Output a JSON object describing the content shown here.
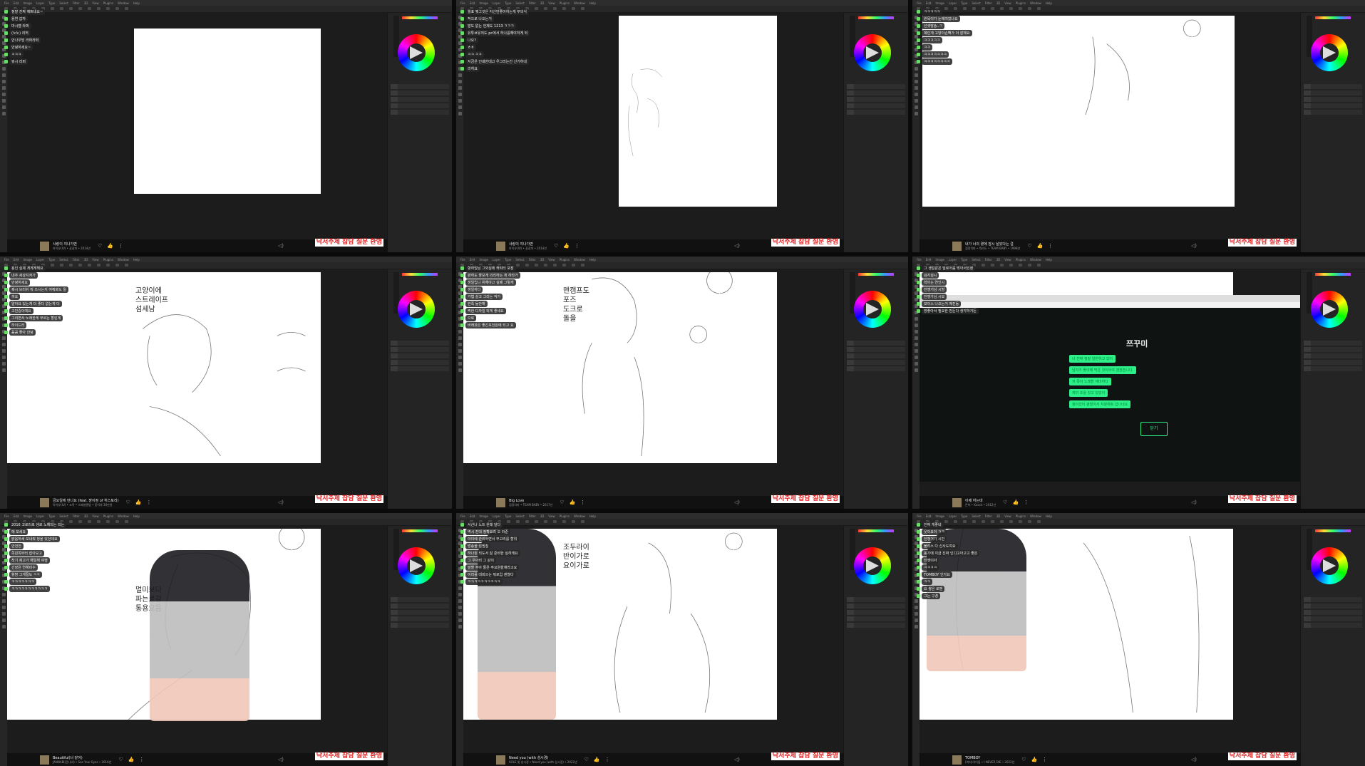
{
  "menu": [
    "File",
    "Edit",
    "Image",
    "Layer",
    "Type",
    "Select",
    "Filter",
    "3D",
    "View",
    "Plugins",
    "Window",
    "Help"
  ],
  "banner_text": "낙서주제 잡담 질문 환영",
  "tiles": [
    {
      "song": {
        "title": "사랑이 지나가면",
        "artist": "아이유(IU) • 꽃갈피 • 2014년"
      },
      "chat": [
        {
          "nick": "",
          "text": "정말 진짜 예쁘네요~"
        },
        {
          "nick": "",
          "text": "용연 갑자"
        },
        {
          "nick": "",
          "text": "마시멜 라퍼"
        },
        {
          "nick": "",
          "text": "(노노) 리허"
        },
        {
          "nick": "",
          "text": "안나우빙 라퍼라퍼"
        },
        {
          "nick": "",
          "text": "안녕하세요~"
        },
        {
          "nick": "",
          "text": "ㅋㅋㅋ"
        },
        {
          "nick": "",
          "text": "뭐시 리퍼"
        }
      ]
    },
    {
      "song": {
        "title": "사랑이 지나가면",
        "artist": "아이유(IU) • 꽃갈피 • 2014년"
      },
      "chat": [
        {
          "nick": "",
          "text": "월표 찢그것은 자신만좋아하는게 무의식"
        },
        {
          "nick": "",
          "text": "적으로 나오는거"
        },
        {
          "nick": "",
          "text": "말도 없는 언제도 1213 ㅋㅋㅋ"
        },
        {
          "nick": "",
          "text": "유튜브유저도 pc에서 하나를해야하게 되"
        },
        {
          "nick": "",
          "text": "나요?"
        },
        {
          "nick": "",
          "text": "ㅎㅎ"
        },
        {
          "nick": "",
          "text": "ㅋㅋ ㅋㅋ"
        },
        {
          "nick": "",
          "text": "지금은 인쇄한데고 우그리는건 신기하네"
        },
        {
          "nick": "",
          "text": "리허요"
        }
      ]
    },
    {
      "song": {
        "title": "내가 너의 곁에 잠시 살았다는 걸",
        "artist": "검정치마 • 뭐라도 • TEAM BABY • 1998년"
      },
      "chat": [
        {
          "nick": "",
          "text": "ㅋㅋㅋㅋㅋ"
        },
        {
          "nick": "",
          "text": "원목이가 눈에띄었나요"
        },
        {
          "nick": "",
          "text": "선셋방송..ㅋ"
        },
        {
          "nick": "",
          "text": "제인게 고양이손뼉가 더 잘해요"
        },
        {
          "nick": "",
          "text": "ㅋㅋㅋㅋㅋ"
        },
        {
          "nick": "",
          "text": "ㅋㅋ"
        },
        {
          "nick": "",
          "text": "ㅋㅋㅋㅋㅋㅋㅋ"
        },
        {
          "nick": "",
          "text": "ㅋㅋㅋㅋㅋㅋㅋㅋ"
        }
      ]
    },
    {
      "song": {
        "title": "금요일에 만나요 (feat. 장이정 of 히스토리)",
        "artist": "아이유(IU) • 조목 • 스페셜앨범 • 동이와 30만원"
      },
      "chat": [
        {
          "nick": "",
          "text": "용인 실제 게게게해요"
        },
        {
          "nick": "",
          "text": "내추 세상지켜가"
        },
        {
          "nick": "",
          "text": "안녕하세요"
        },
        {
          "nick": "",
          "text": "혹시 브러쉬 뭐 쓰시는지 여쭤봐도 될"
        },
        {
          "nick": "",
          "text": "까요"
        },
        {
          "nick": "",
          "text": "알아요 있는게 더 좋다 없는게 더"
        },
        {
          "nick": "",
          "text": "고민중이예요"
        },
        {
          "nick": "",
          "text": "그리면서 노래한게 부르는 할린게"
        },
        {
          "nick": "",
          "text": "하이드라"
        },
        {
          "nick": "",
          "text": "꼼꼼 좋아 안녕"
        }
      ],
      "notes": [
        "고양이에",
        "스트레이프",
        "섬세남"
      ]
    },
    {
      "song": {
        "title": "Big Love",
        "artist": "검정치마 • TEAM BABY • 2017년"
      },
      "chat": [
        {
          "nick": "",
          "text": "항하임님 그외실에 캐릭터 포장"
        },
        {
          "nick": "",
          "text": "판하도 꽃보게 의리하는 게 하라가"
        },
        {
          "nick": "",
          "text": "생일입니 위해야고 실패 그렇게"
        },
        {
          "nick": "",
          "text": "생일하다"
        },
        {
          "nick": "",
          "text": "가볍 살고 그리는 작가"
        },
        {
          "nick": "",
          "text": "한쪽 들안해"
        },
        {
          "nick": "",
          "text": "찍한 디자일 되게 좋네요"
        },
        {
          "nick": "",
          "text": "으로"
        },
        {
          "nick": "",
          "text": "바래왔은 좋긴포천원에 되고 요"
        }
      ],
      "notes": [
        "맨캠프도",
        "포즈",
        "도크로",
        "돌을"
      ]
    },
    {
      "song": {
        "title": "이제 하는대",
        "artist": "몬박 • Knock • 2012년"
      },
      "chat": [
        {
          "nick": "",
          "text": "그 생일같은 빌로어를 밖아서있정"
        },
        {
          "nick": "",
          "text": "검지설시"
        },
        {
          "nick": "",
          "text": "학이는 연인시"
        },
        {
          "nick": "",
          "text": "전쟁거님 시방"
        },
        {
          "nick": "",
          "text": "전쟁가님 시보"
        },
        {
          "nick": "",
          "text": "보이스 나오는거 께진동"
        },
        {
          "nick": "",
          "text": "방좋아서 필요한 만든다 생각하거든"
        }
      ],
      "browser": {
        "logo": "쯔꾸미",
        "bubbles": [
          "너 진짜 정말 일반하고 있어",
          "남자가 좋아해 먹은 것이어야 괜찮습니다.",
          "저 쪽이 노래할 재미하다",
          "재미 조용 짓고 있었어",
          "참이었어 괜찮아서 처분해줘 겁나네요"
        ],
        "close": "닫기"
      }
    },
    {
      "song": {
        "title": "Beautiful(너 같아)",
        "artist": "JANNABI(잔나비) • See Your Eyes • 2016년"
      },
      "chat": [
        {
          "nick": "",
          "text": "2016 고로러로 생로 노해되는 되는"
        },
        {
          "nick": "",
          "text": "에 보세요"
        },
        {
          "nick": "",
          "text": "맑음하세 보내줘 정을 있던데요"
        },
        {
          "nick": "",
          "text": "안전전"
        },
        {
          "nick": "",
          "text": "쪽왼쪽부터 잡아보고"
        },
        {
          "nick": "",
          "text": "착기 제고가 해일해 여행"
        },
        {
          "nick": "",
          "text": "긴장은 연해미수"
        },
        {
          "nick": "",
          "text": "항밤 그게절도 ㅋㅋ"
        },
        {
          "nick": "",
          "text": "ㅋㅋㅋㅋㅋㅋㅋ"
        },
        {
          "nick": "",
          "text": "ㅋㅋㅋㅋㅋㅋㅋㅋㅋㅋㅋ"
        }
      ],
      "notes": [
        "멀미보다",
        "파는로강",
        "통용요음"
      ]
    },
    {
      "song": {
        "title": "Need you (with 성시경)",
        "artist": "SOLE 및 성시경 • Need you (with 성시경) • 2022년"
      },
      "chat": [
        {
          "nick": "",
          "text": "서산나 노트 원래 달다"
        },
        {
          "nick": "",
          "text": "역시 진대 정확요리 오 라준"
        },
        {
          "nick": "",
          "text": "아이에 관리하면서 무고리를 할위"
        },
        {
          "nick": "",
          "text": "방송을 설핌칠"
        },
        {
          "nick": "",
          "text": "하나원 되도서 잘 준비한 실하게요"
        },
        {
          "nick": "",
          "text": "그 우아비 그 같이"
        },
        {
          "nick": "",
          "text": "말할 주아 둘은 주요원을재라고요"
        },
        {
          "nick": "",
          "text": "이러를 대회쓰는 뭐로입 괜찮다"
        },
        {
          "nick": "",
          "text": "ㅋㅋㅋㅋㅋㅋㅋㅋㅋㅋ"
        }
      ],
      "notes": [
        "조두라이",
        "반이가로",
        "요이가로"
      ]
    },
    {
      "song": {
        "title": "TOMBOY",
        "artist": "(여자)아이들 • I NEVER DIE • 2022년"
      },
      "chat": [
        {
          "nick": "",
          "text": "진짜 게좋네"
        },
        {
          "nick": "",
          "text": "웃이요이 ㅋㅋ"
        },
        {
          "nick": "",
          "text": "전쟁거기 시민"
        },
        {
          "nick": "",
          "text": "불리스 다 신사도여요"
        },
        {
          "nick": "",
          "text": "동기에 지금 진짜 인디고아고고 좋은"
        },
        {
          "nick": "",
          "text": "전쟁이야"
        },
        {
          "nick": "",
          "text": "ㅋㅋㅋㅋ"
        },
        {
          "nick": "",
          "text": "TOMBOY 인가요"
        },
        {
          "nick": "",
          "text": "ㅋㅋ"
        },
        {
          "nick": "",
          "text": "요 쌓은 로맨"
        },
        {
          "nick": "",
          "text": "그는 구경"
        }
      ]
    }
  ]
}
